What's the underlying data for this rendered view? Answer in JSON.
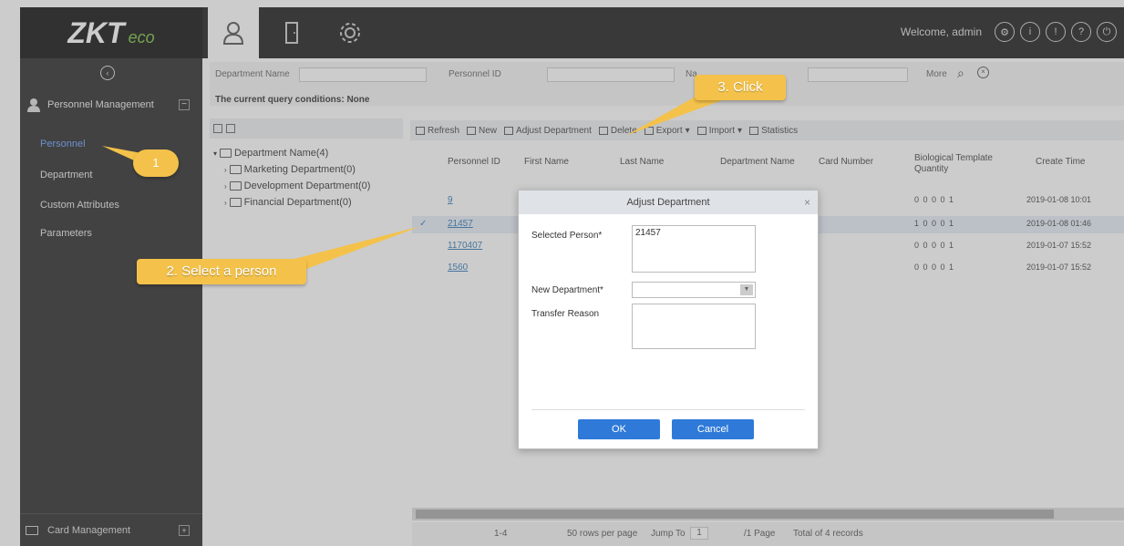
{
  "app": {
    "logo": "ZKT",
    "logo_suffix": "eco",
    "welcome": "Welcome, admin"
  },
  "sidebar": {
    "section": "Personnel Management",
    "items": [
      {
        "label": "Personnel",
        "active": true
      },
      {
        "label": "Department"
      },
      {
        "label": "Custom Attributes"
      },
      {
        "label": "Parameters"
      }
    ],
    "bottom": "Card Management"
  },
  "query": {
    "dept_label": "Department Name",
    "personnel_label": "Personnel ID",
    "name_label": "Na",
    "more": "More",
    "conditions": "The current query conditions: None"
  },
  "tree": {
    "root": "Department Name(4)",
    "children": [
      "Marketing Department(0)",
      "Development Department(0)",
      "Financial Department(0)"
    ]
  },
  "toolbar": {
    "refresh": "Refresh",
    "new": "New",
    "adjust": "Adjust Department",
    "delete": "Delete",
    "export": "Export",
    "import": "Import",
    "statistics": "Statistics"
  },
  "table": {
    "headers": {
      "pid": "Personnel ID",
      "first": "First Name",
      "last": "Last Name",
      "dept": "Department Name",
      "card": "Card Number",
      "bio": "Biological Template Quantity",
      "ctime": "Create Time"
    },
    "rows": [
      {
        "pid": "9",
        "bio": "0 0 0 0 1",
        "ctime": "2019-01-08 10:01"
      },
      {
        "pid": "21457",
        "bio": "1 0 0 0 1",
        "ctime": "2019-01-08 01:46"
      },
      {
        "pid": "1170407",
        "bio": "0 0 0 0 1",
        "ctime": "2019-01-07 15:52"
      },
      {
        "pid": "1560",
        "bio": "0 0 0 0 1",
        "ctime": "2019-01-07 15:52"
      }
    ],
    "pager": {
      "range": "1-4",
      "per_page": "50 rows per page",
      "jump": "Jump To",
      "page": "1",
      "of_page": "/1 Page",
      "total": "Total of 4 records"
    }
  },
  "dialog": {
    "title": "Adjust Department",
    "selected_label": "Selected Person*",
    "selected_value": "21457",
    "new_dept_label": "New Department*",
    "reason_label": "Transfer Reason",
    "ok": "OK",
    "cancel": "Cancel"
  },
  "callouts": {
    "step1": "1",
    "step2": "2. Select a person",
    "step3": "3. Click"
  },
  "colors": {
    "callout": "#f4c24a",
    "primary_button": "#2f7ad9",
    "sidebar_bg": "#2b2b2b",
    "topbar_bg": "#1e1e1e"
  }
}
